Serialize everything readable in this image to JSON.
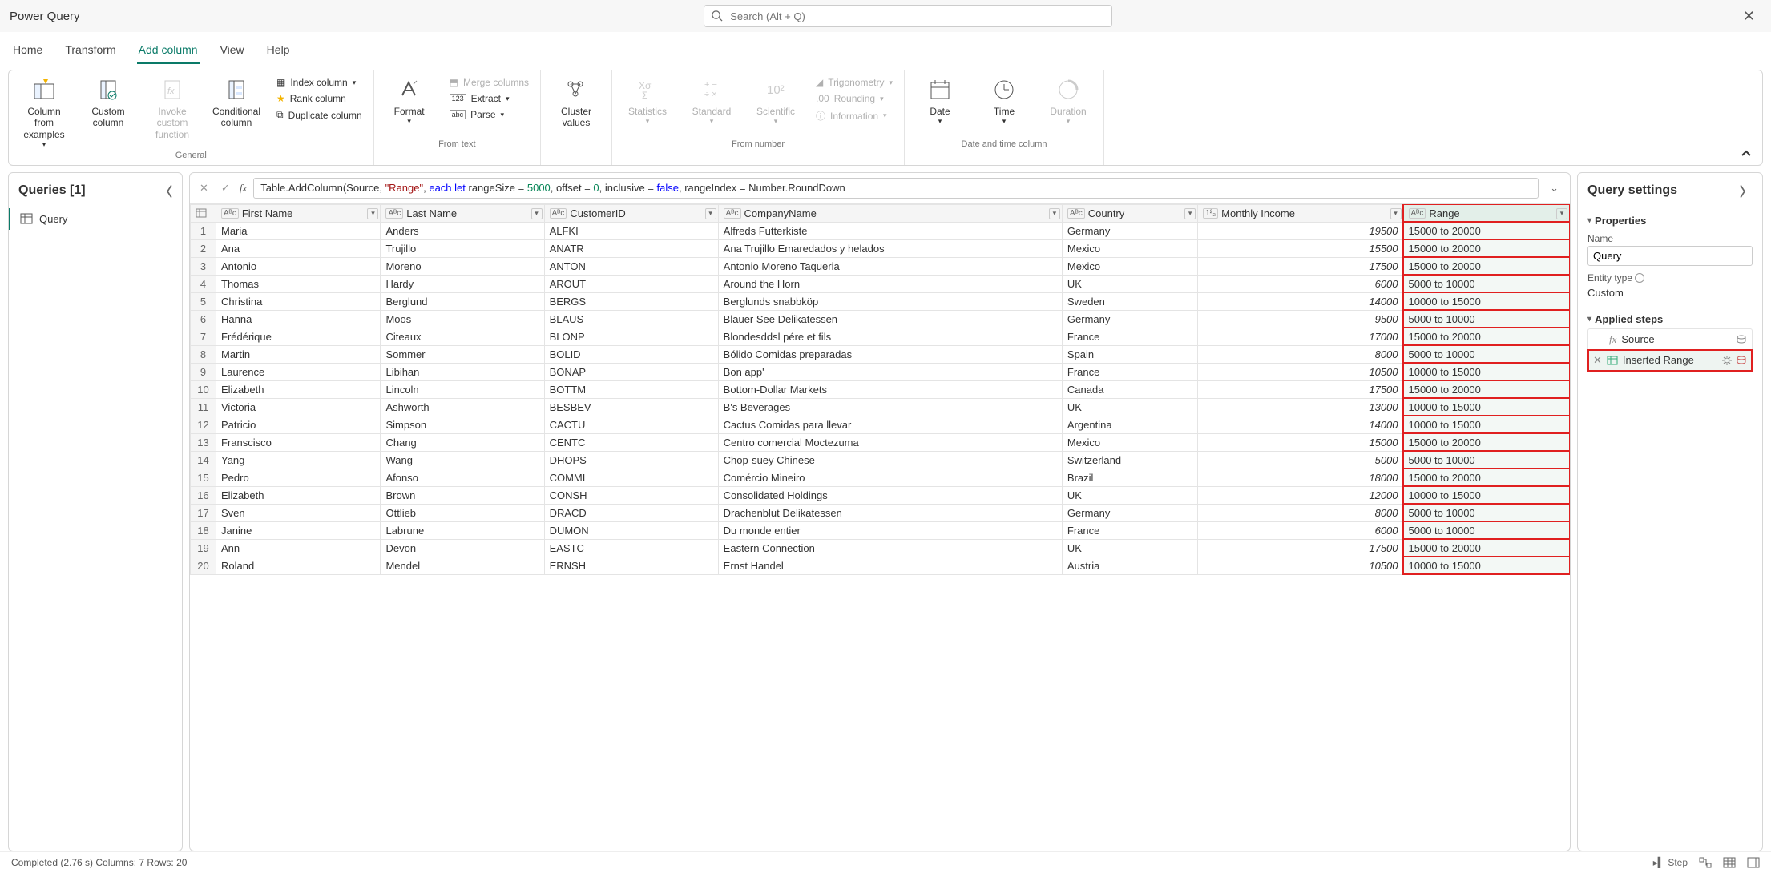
{
  "app_title": "Power Query",
  "search_placeholder": "Search (Alt + Q)",
  "tabs": [
    "Home",
    "Transform",
    "Add column",
    "View",
    "Help"
  ],
  "active_tab": 2,
  "ribbon": {
    "groups": [
      {
        "label": "General",
        "big": [
          "Column from examples",
          "Custom column",
          "Invoke custom function",
          "Conditional column"
        ],
        "small": [
          "Index column",
          "Rank column",
          "Duplicate column"
        ]
      },
      {
        "label": "From text",
        "big": [
          "Format"
        ],
        "small": [
          "Merge columns",
          "Extract",
          "Parse"
        ]
      },
      {
        "label": "",
        "big": [
          "Cluster values"
        ],
        "small": []
      },
      {
        "label": "From number",
        "big": [
          "Statistics",
          "Standard",
          "Scientific"
        ],
        "small": [
          "Trigonometry",
          "Rounding",
          "Information"
        ]
      },
      {
        "label": "Date and time column",
        "big": [
          "Date",
          "Time",
          "Duration"
        ],
        "small": []
      }
    ]
  },
  "formula_parts": {
    "p1": "Table.AddColumn(Source, ",
    "p2": "\"Range\"",
    "p3": ", ",
    "p4": "each let",
    "p5": " rangeSize = ",
    "p6": "5000",
    "p7": ", offset = ",
    "p8": "0",
    "p9": ", inclusive = ",
    "p10": "false",
    "p11": ", rangeIndex = Number.RoundDown"
  },
  "queries_label": "Queries [1]",
  "query_items": [
    "Query"
  ],
  "columns": [
    {
      "name": "First Name",
      "type": "ABC"
    },
    {
      "name": "Last Name",
      "type": "ABC"
    },
    {
      "name": "CustomerID",
      "type": "ABC"
    },
    {
      "name": "CompanyName",
      "type": "ABC"
    },
    {
      "name": "Country",
      "type": "ABC"
    },
    {
      "name": "Monthly Income",
      "type": "123"
    },
    {
      "name": "Range",
      "type": "ABC",
      "selected": true
    }
  ],
  "rows": [
    [
      "Maria",
      "Anders",
      "ALFKI",
      "Alfreds Futterkiste",
      "Germany",
      "19500",
      "15000 to 20000"
    ],
    [
      "Ana",
      "Trujillo",
      "ANATR",
      "Ana Trujillo Emaredados y helados",
      "Mexico",
      "15500",
      "15000 to 20000"
    ],
    [
      "Antonio",
      "Moreno",
      "ANTON",
      "Antonio Moreno Taqueria",
      "Mexico",
      "17500",
      "15000 to 20000"
    ],
    [
      "Thomas",
      "Hardy",
      "AROUT",
      "Around the Horn",
      "UK",
      "6000",
      "5000 to 10000"
    ],
    [
      "Christina",
      "Berglund",
      "BERGS",
      "Berglunds snabbköp",
      "Sweden",
      "14000",
      "10000 to 15000"
    ],
    [
      "Hanna",
      "Moos",
      "BLAUS",
      "Blauer See Delikatessen",
      "Germany",
      "9500",
      "5000 to 10000"
    ],
    [
      "Frédérique",
      "Citeaux",
      "BLONP",
      "Blondesddsl pére et fils",
      "France",
      "17000",
      "15000 to 20000"
    ],
    [
      "Martin",
      "Sommer",
      "BOLID",
      "Bólido Comidas preparadas",
      "Spain",
      "8000",
      "5000 to 10000"
    ],
    [
      "Laurence",
      "Libihan",
      "BONAP",
      "Bon app'",
      "France",
      "10500",
      "10000 to 15000"
    ],
    [
      "Elizabeth",
      "Lincoln",
      "BOTTM",
      "Bottom-Dollar Markets",
      "Canada",
      "17500",
      "15000 to 20000"
    ],
    [
      "Victoria",
      "Ashworth",
      "BESBEV",
      "B's Beverages",
      "UK",
      "13000",
      "10000 to 15000"
    ],
    [
      "Patricio",
      "Simpson",
      "CACTU",
      "Cactus Comidas para llevar",
      "Argentina",
      "14000",
      "10000 to 15000"
    ],
    [
      "Franscisco",
      "Chang",
      "CENTC",
      "Centro comercial Moctezuma",
      "Mexico",
      "15000",
      "15000 to 20000"
    ],
    [
      "Yang",
      "Wang",
      "DHOPS",
      "Chop-suey Chinese",
      "Switzerland",
      "5000",
      "5000 to 10000"
    ],
    [
      "Pedro",
      "Afonso",
      "COMMI",
      "Comércio Mineiro",
      "Brazil",
      "18000",
      "15000 to 20000"
    ],
    [
      "Elizabeth",
      "Brown",
      "CONSH",
      "Consolidated Holdings",
      "UK",
      "12000",
      "10000 to 15000"
    ],
    [
      "Sven",
      "Ottlieb",
      "DRACD",
      "Drachenblut Delikatessen",
      "Germany",
      "8000",
      "5000 to 10000"
    ],
    [
      "Janine",
      "Labrune",
      "DUMON",
      "Du monde entier",
      "France",
      "6000",
      "5000 to 10000"
    ],
    [
      "Ann",
      "Devon",
      "EASTC",
      "Eastern Connection",
      "UK",
      "17500",
      "15000 to 20000"
    ],
    [
      "Roland",
      "Mendel",
      "ERNSH",
      "Ernst Handel",
      "Austria",
      "10500",
      "10000 to 15000"
    ]
  ],
  "settings": {
    "title": "Query settings",
    "properties_label": "Properties",
    "name_label": "Name",
    "name_value": "Query",
    "entity_type_label": "Entity type",
    "entity_type_value": "Custom",
    "applied_steps_label": "Applied steps",
    "steps": [
      {
        "label": "Source",
        "fx": true
      },
      {
        "label": "Inserted Range",
        "selected": true
      }
    ]
  },
  "status": {
    "left": "Completed (2.76 s)    Columns: 7    Rows: 20",
    "step_label": "Step"
  }
}
